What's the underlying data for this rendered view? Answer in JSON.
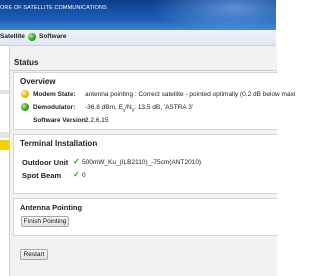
{
  "header": {
    "title": "ORE OF SATELLITE COMMUNICATIONS"
  },
  "nav": {
    "items": [
      {
        "label": "Satellite"
      },
      {
        "label": "Software"
      }
    ]
  },
  "status": {
    "heading": "Status"
  },
  "overview": {
    "heading": "Overview",
    "modem_label": "Modem State:",
    "modem_value": "antenna pointing : Correct satellite - pointed optimally (0.2 dB below maxi",
    "demod_label": "Demodulator:",
    "demod_value_prefix": "-36.8 dBm, E",
    "demod_value_sub1": "s",
    "demod_value_mid": "/N",
    "demod_value_sub2": "0",
    "demod_value_suffix": ": 13.5 dB, 'ASTRA 3'",
    "software_label": "Software Version:",
    "software_value": "2.2.6.15"
  },
  "terminal": {
    "heading": "Terminal Installation",
    "odu_label": "Outdoor Unit",
    "odu_check": "✓",
    "odu_value": "500mW_Ku_(ILB2110)_-75cm(ANT2010)",
    "spot_label": "Spot Beam",
    "spot_check": "✓",
    "spot_value": "0"
  },
  "antenna": {
    "heading": "Antenna Pointing",
    "finish_button": "Finish Pointing"
  },
  "restart_button": "Restart",
  "colors": {
    "header_blue": "#1d5fb8",
    "ok_green": "#2e9d1e",
    "warn_yellow": "#e2b300"
  }
}
